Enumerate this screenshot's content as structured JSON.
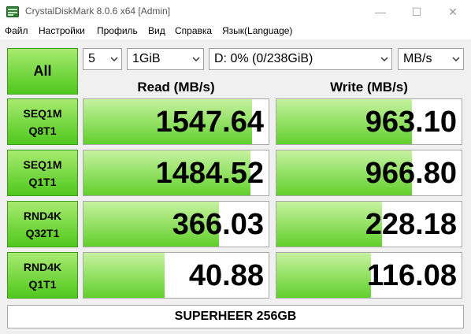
{
  "window": {
    "title": "CrystalDiskMark 8.0.6 x64 [Admin]",
    "minimize": "—",
    "maximize": "☐",
    "close": "✕"
  },
  "menu": [
    "Файл",
    "Настройки",
    "Профиль",
    "Вид",
    "Справка",
    "Язык(Language)"
  ],
  "controls": {
    "all_label": "All",
    "count": "5",
    "size": "1GiB",
    "drive": "D: 0% (0/238GiB)",
    "unit": "MB/s"
  },
  "headers": {
    "read": "Read (MB/s)",
    "write": "Write (MB/s)"
  },
  "tests": [
    {
      "line1": "SEQ1M",
      "line2": "Q8T1",
      "read": "1547.64",
      "write": "963.10",
      "read_fill": 0.91,
      "write_fill": 0.73
    },
    {
      "line1": "SEQ1M",
      "line2": "Q1T1",
      "read": "1484.52",
      "write": "966.80",
      "read_fill": 0.9,
      "write_fill": 0.73
    },
    {
      "line1": "RND4K",
      "line2": "Q32T1",
      "read": "366.03",
      "write": "228.18",
      "read_fill": 0.73,
      "write_fill": 0.57
    },
    {
      "line1": "RND4K",
      "line2": "Q1T1",
      "read": "40.88",
      "write": "116.08",
      "read_fill": 0.44,
      "write_fill": 0.51
    }
  ],
  "footer": "SUPERHEER 256GB"
}
